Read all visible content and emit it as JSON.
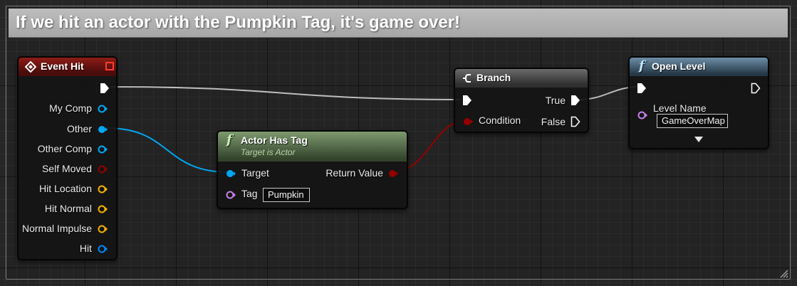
{
  "comment": {
    "title": "If we hit an actor with the Pumpkin Tag, it's game over!"
  },
  "nodes": {
    "event_hit": {
      "title": "Event Hit",
      "outputs": [
        "My Comp",
        "Other",
        "Other Comp",
        "Self Moved",
        "Hit Location",
        "Hit Normal",
        "Normal Impulse",
        "Hit"
      ]
    },
    "actor_has_tag": {
      "icon": "f",
      "title": "Actor Has Tag",
      "subtitle": "Target is Actor",
      "inputs": [
        "Target",
        "Tag"
      ],
      "tag_value": "Pumpkin",
      "output": "Return Value"
    },
    "branch": {
      "title": "Branch",
      "condition_label": "Condition",
      "true_label": "True",
      "false_label": "False"
    },
    "open_level": {
      "icon": "f",
      "title": "Open Level",
      "level_name_label": "Level Name",
      "level_name_value": "GameOverMap"
    }
  },
  "colors": {
    "exec_wire": "#bdbdbd",
    "object_pin": "#00a8f3",
    "bool_pin": "#950000",
    "name_pin": "#c680e8",
    "struct_pin": "#f2b000",
    "hit_pin": "#0088ff",
    "event_header": "#8d1c17",
    "pure_func_header": "#7e9a6f",
    "func_header": "#6d8ea7"
  }
}
